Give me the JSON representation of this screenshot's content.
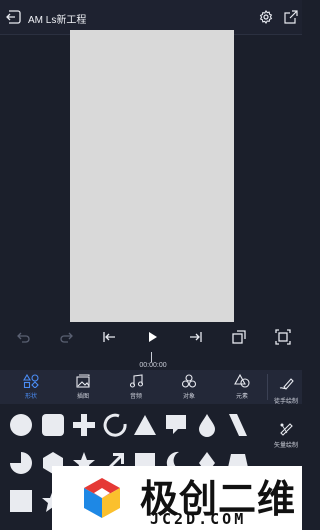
{
  "header": {
    "title": "AM Ls新工程",
    "back_icon": "back-arrow-icon",
    "settings_icon": "gear-icon",
    "export_icon": "export-icon"
  },
  "timeline": {
    "time": "00:00:00"
  },
  "tabs": [
    {
      "label": "形状",
      "icon": "shape-icon",
      "active": true
    },
    {
      "label": "插图",
      "icon": "image-icon",
      "active": false
    },
    {
      "label": "音频",
      "icon": "music-icon",
      "active": false
    },
    {
      "label": "对象",
      "icon": "object-icon",
      "active": false
    },
    {
      "label": "元素",
      "icon": "element-icon",
      "active": false
    }
  ],
  "side_tools": [
    {
      "label": "徒手绘制",
      "icon": "freehand-draw-icon"
    },
    {
      "label": "矢量绘制",
      "icon": "vector-draw-icon"
    }
  ],
  "controls": [
    "undo-icon",
    "redo-icon",
    "skip-start-icon",
    "play-icon",
    "skip-end-icon",
    "loop-icon",
    "fit-screen-icon"
  ],
  "watermark": {
    "cn": "极创二维",
    "en": "JC2D.COM"
  },
  "colors": {
    "accent": "#4b8df5",
    "background": "#1b1f2b",
    "canvas": "#d9d9d9",
    "shape": "#e9ebf0"
  }
}
